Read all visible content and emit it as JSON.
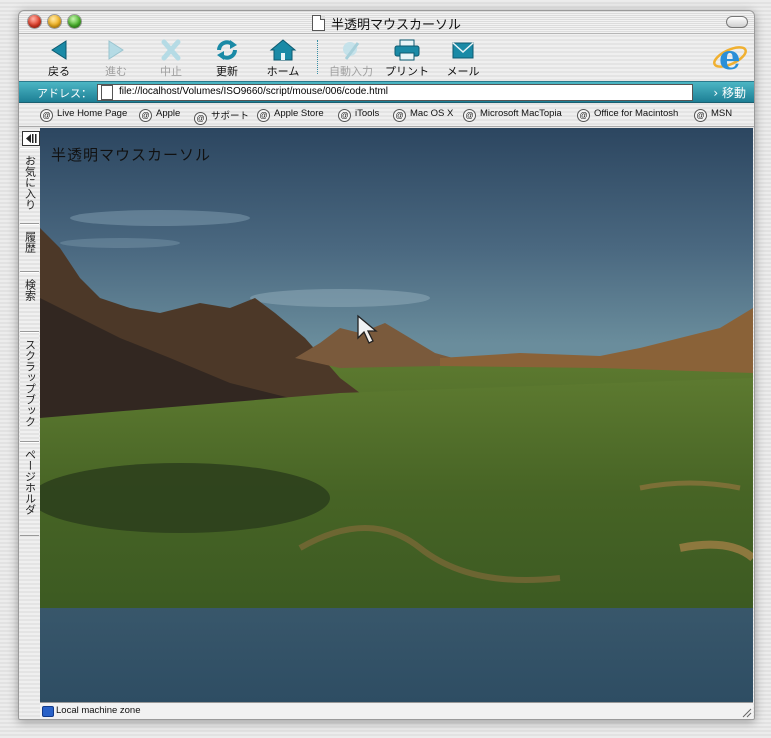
{
  "window": {
    "title": "半透明マウスカーソル"
  },
  "toolbar": {
    "back": "戻る",
    "forward": "進む",
    "stop": "中止",
    "refresh": "更新",
    "home": "ホーム",
    "autofill": "自動入力",
    "print": "プリント",
    "mail": "メール"
  },
  "address": {
    "label": "アドレス：",
    "url": "file://localhost/Volumes/ISO9660/script/mouse/006/code.html",
    "go": "移動"
  },
  "favorites": [
    "Live Home Page",
    "Apple",
    "サポート",
    "Apple Store",
    "iTools",
    "Mac OS X",
    "Microsoft MacTopia",
    "Office for Macintosh",
    "MSN"
  ],
  "sidebar": {
    "tabs": [
      "お気に入り",
      "履歴",
      "検索",
      "スクラップブック",
      "ページホルダ"
    ]
  },
  "content": {
    "heading": "半透明マウスカーソル"
  },
  "status": {
    "zone": "Local machine zone"
  },
  "colors": {
    "accent": "#1d7f95",
    "toolbar_icon": "#1a8aa6"
  }
}
